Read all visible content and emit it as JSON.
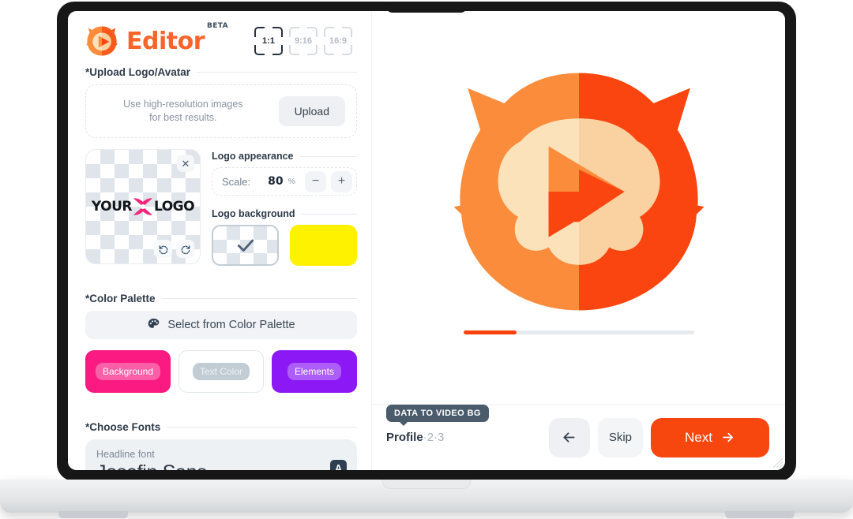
{
  "brand": {
    "name": "Editor",
    "badge": "BETA",
    "logo_icon": "lion-play-logo",
    "accent_color": "#f9642a"
  },
  "aspect_ratios": {
    "options": [
      {
        "label": "1:1",
        "selected": true
      },
      {
        "label": "9:16",
        "selected": false
      },
      {
        "label": "16:9",
        "selected": false
      }
    ]
  },
  "upload_section": {
    "heading": "*Upload Logo/Avatar",
    "hint_line1": "Use high-resolution images",
    "hint_line2": "for best results.",
    "upload_label": "Upload"
  },
  "logo_preview": {
    "text_left": "YOUR",
    "text_right": "LOGO",
    "flower_icon": "flower-mark",
    "flower_color": "#f0277d",
    "remove_icon": "close-icon",
    "rotate_left_icon": "rotate-counterclockwise-icon",
    "rotate_right_icon": "rotate-clockwise-icon"
  },
  "logo_appearance": {
    "heading": "Logo appearance",
    "scale_label": "Scale:",
    "scale_value": "80",
    "scale_unit": "%",
    "decrease_icon": "minus-icon",
    "increase_icon": "plus-icon"
  },
  "logo_background": {
    "heading": "Logo background",
    "swatches": [
      {
        "name": "transparent",
        "selected": true,
        "check_icon": "check-icon"
      },
      {
        "name": "yellow",
        "color": "#fff200",
        "selected": false
      }
    ]
  },
  "color_palette": {
    "heading": "*Color Palette",
    "select_label": "Select from Color Palette",
    "palette_icon": "palette-icon",
    "swatches": [
      {
        "label": "Background",
        "color": "#fa1a82"
      },
      {
        "label": "Text Color",
        "color": "#ffffff"
      },
      {
        "label": "Elements",
        "color": "#8c19f5"
      }
    ]
  },
  "fonts": {
    "heading": "*Choose Fonts",
    "kind": "Headline font",
    "name": "Josefin Sans",
    "badge": "A"
  },
  "preview": {
    "artwork": "lion-head-play-logo",
    "colors": {
      "mane_light": "#fb8c3c",
      "mane_dark": "#fb4510",
      "face_light": "#fce2bb",
      "face_dark": "#fad1a0",
      "play_light": "#fb8c3c",
      "play_dark": "#fb4510"
    },
    "progress_percent": 23,
    "progress_color": "#f8410c"
  },
  "bottom_bar": {
    "tooltip": "DATA TO VIDEO BG",
    "step_current": "Profile",
    "step_sep": "·",
    "step_2": "2",
    "step_3": "3",
    "back_icon": "arrow-left-icon",
    "skip_label": "Skip",
    "next_label": "Next",
    "next_icon": "arrow-right-icon"
  }
}
